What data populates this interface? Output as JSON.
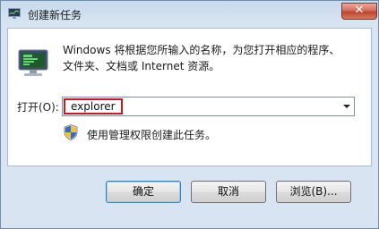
{
  "window": {
    "title": "创建新任务",
    "close_label": "✕"
  },
  "dialog": {
    "description_line1": "Windows 将根据您所输入的名称，为您打开相应的程序、",
    "description_line2": "文件夹、文档或 Internet 资源。",
    "open_label": "打开(O):",
    "open_value": "explorer",
    "admin_note": "使用管理权限创建此任务。"
  },
  "buttons": {
    "ok": "确定",
    "cancel": "取消",
    "browse": "浏览(B)..."
  },
  "colors": {
    "highlight_border": "#d0161c",
    "default_button_border": "#3c7fb1",
    "close_button": "#c0432c"
  },
  "icons": {
    "app": "task-manager-icon",
    "run": "run-dialog-icon",
    "shield": "uac-shield-icon"
  }
}
